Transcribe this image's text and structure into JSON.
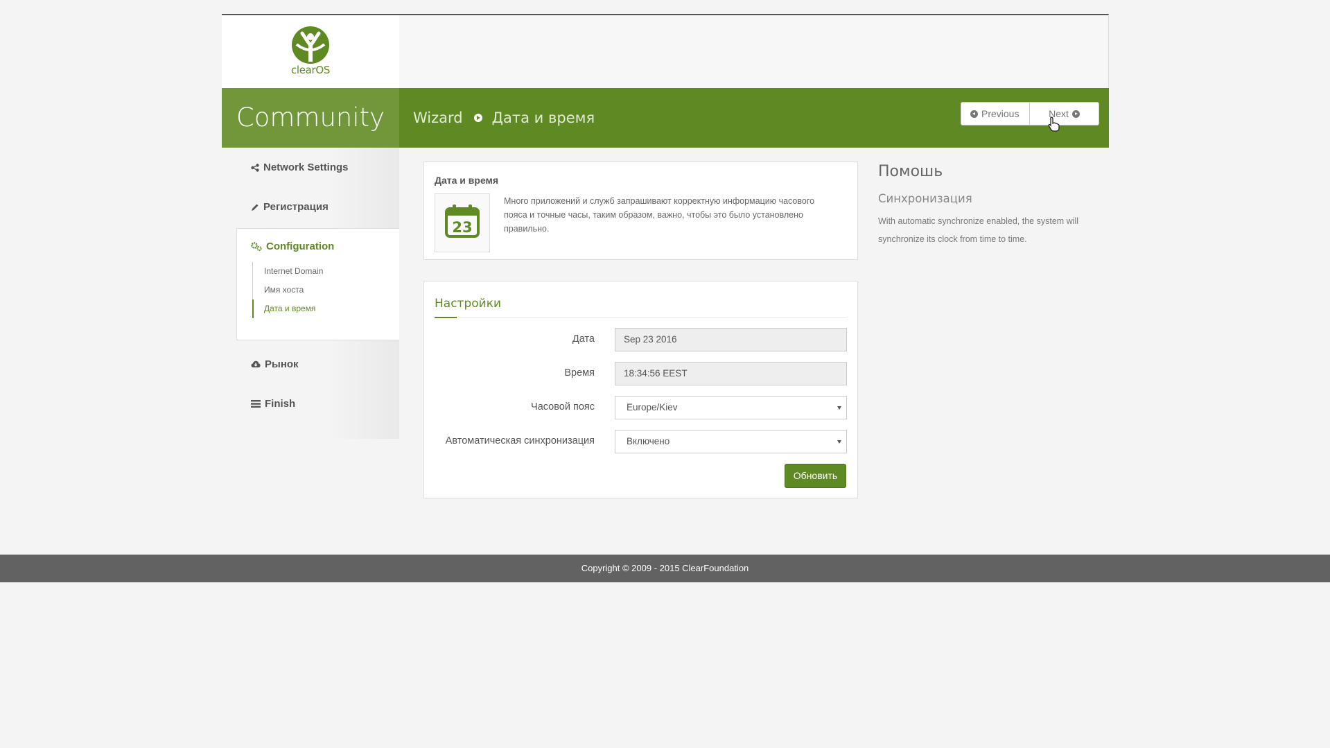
{
  "brand": {
    "logo_text": "clearOS",
    "edition": "Community",
    "accent": "#5f8a23"
  },
  "breadcrumb": {
    "root": "Wizard",
    "current": "Дата и время"
  },
  "wizard_nav": {
    "previous": "Previous",
    "next": "Next"
  },
  "sidebar": {
    "items": [
      {
        "label": "Network Settings",
        "icon": "share-icon"
      },
      {
        "label": "Регистрация",
        "icon": "pencil-icon"
      },
      {
        "label": "Configuration",
        "icon": "gears-icon"
      },
      {
        "label": "Рынок",
        "icon": "cloud-download-icon"
      },
      {
        "label": "Finish",
        "icon": "list-icon"
      }
    ],
    "config_subitems": [
      "Internet Domain",
      "Имя хоста",
      "Дата и время"
    ]
  },
  "info_panel": {
    "title": "Дата и время",
    "icon_day": "23",
    "description": "Много приложений и служб запрашивают корректную информацию часового пояса и точные часы, таким образом, важно, чтобы это было установлено правильно."
  },
  "settings": {
    "title": "Настройки",
    "date_label": "Дата",
    "date_value": "Sep 23 2016",
    "time_label": "Время",
    "time_value": "18:34:56 EEST",
    "timezone_label": "Часовой пояс",
    "timezone_value": "Europe/Kiev",
    "autosync_label": "Автоматическая синхронизация",
    "autosync_value": "Включено",
    "update_button": "Обновить"
  },
  "help": {
    "title": "Помошь",
    "subtitle": "Синхронизация",
    "text": "With automatic synchronize enabled, the system will synchronize its clock from time to time."
  },
  "footer": {
    "copyright": "Copyright © 2009 - 2015 ClearFoundation"
  }
}
